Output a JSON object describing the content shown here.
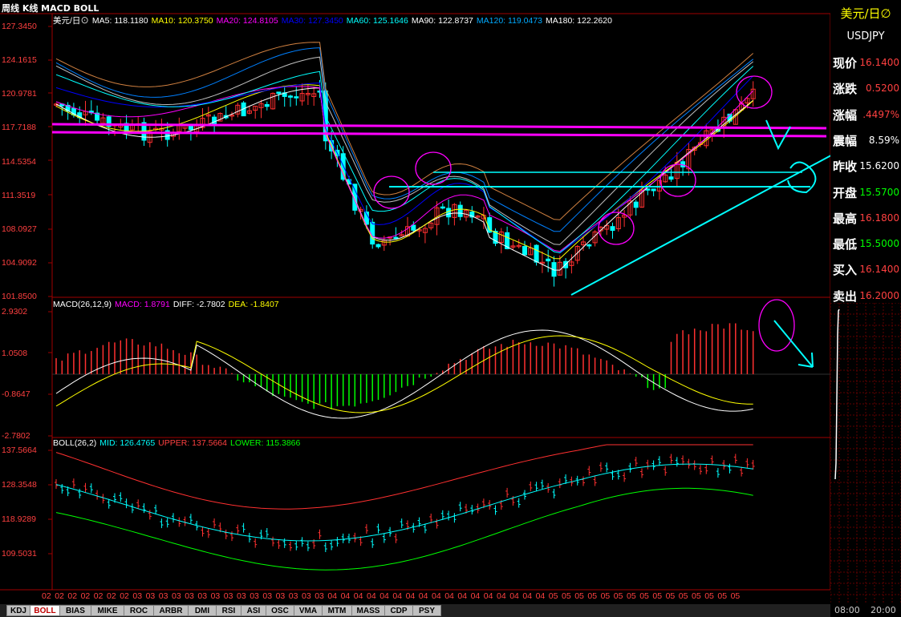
{
  "window": {
    "title": "周线 K线 MACD BOLL"
  },
  "price_panel": {
    "legend": [
      {
        "text": "美元/日⊙",
        "color": "#ffffff"
      },
      {
        "text": "MA5: 118.1180",
        "color": "#ffffff"
      },
      {
        "text": "MA10: 120.3750",
        "color": "#ffff00"
      },
      {
        "text": "MA20: 124.8105",
        "color": "#ff00ff"
      },
      {
        "text": "MA30: 127.3450",
        "color": "#0000ff"
      },
      {
        "text": "MA60: 125.1646",
        "color": "#00ffff"
      },
      {
        "text": "MA90: 122.8737",
        "color": "#ffffff"
      },
      {
        "text": "MA120: 119.0473",
        "color": "#00aaff"
      },
      {
        "text": "MA180: 122.2620",
        "color": "#ffffff"
      }
    ],
    "y_ticks": [
      "127.3450",
      "124.1615",
      "120.9781",
      "117.7188",
      "114.5354",
      "111.3519",
      "108.0927",
      "104.9092",
      "101.8500"
    ]
  },
  "macd_panel": {
    "legend": [
      {
        "text": "MACD(26,12,9)",
        "color": "#ffffff"
      },
      {
        "text": "MACD: 1.8791",
        "color": "#ff00ff"
      },
      {
        "text": "DIFF: -2.7802",
        "color": "#ffffff"
      },
      {
        "text": "DEA: -1.8407",
        "color": "#ffff00"
      }
    ],
    "y_ticks": [
      "2.9302",
      "1.0508",
      "-0.8647",
      "-2.7802"
    ]
  },
  "boll_panel": {
    "legend": [
      {
        "text": "BOLL(26,2)",
        "color": "#ffffff"
      },
      {
        "text": "MID: 126.4765",
        "color": "#00ffff"
      },
      {
        "text": "UPPER: 137.5664",
        "color": "#ff4040"
      },
      {
        "text": "LOWER: 115.3866",
        "color": "#00ff00"
      }
    ],
    "y_ticks": [
      "137.5664",
      "128.3548",
      "118.9289",
      "109.5031"
    ]
  },
  "x_axis_labels": [
    "02",
    "02",
    "02",
    "02",
    "02",
    "02",
    "02",
    "03",
    "03",
    "03",
    "03",
    "03",
    "03",
    "03",
    "03",
    "03",
    "03",
    "03",
    "03",
    "03",
    "03",
    "03",
    "04",
    "04",
    "04",
    "04",
    "04",
    "04",
    "04",
    "04",
    "04",
    "04",
    "04",
    "04",
    "04",
    "04",
    "04",
    "04",
    "04",
    "05",
    "05",
    "05",
    "05",
    "05",
    "05",
    "05",
    "05",
    "05",
    "05",
    "05",
    "05",
    "05",
    "05",
    "05"
  ],
  "quote": {
    "title": "美元/日∅",
    "code": "USDJPY",
    "rows": [
      {
        "label": "现价",
        "value": "16.1400",
        "color": "#ff4040"
      },
      {
        "label": "涨跌",
        "value": "0.5200",
        "color": "#ff4040"
      },
      {
        "label": "涨幅",
        "value": ".4497%",
        "color": "#ff4040"
      },
      {
        "label": "震幅",
        "value": "8.59%",
        "color": "#ffffff"
      },
      {
        "label": "昨收",
        "value": "15.6200",
        "color": "#ffffff"
      },
      {
        "label": "开盘",
        "value": "15.5700",
        "color": "#00ff00"
      },
      {
        "label": "最高",
        "value": "16.1800",
        "color": "#ff4040"
      },
      {
        "label": "最低",
        "value": "15.5000",
        "color": "#00ff00"
      },
      {
        "label": "买入",
        "value": "16.1400",
        "color": "#ff4040"
      },
      {
        "label": "卖出",
        "value": "16.2000",
        "color": "#ff4040"
      }
    ]
  },
  "mini_chart": {
    "times": [
      "08:00",
      "20:00"
    ]
  },
  "tabs": [
    "KDJ",
    "BOLL",
    "BIAS",
    "MIKE",
    "ROC",
    "ARBR",
    "DMI",
    "RSI",
    "ASI",
    "OSC",
    "VMA",
    "MTM",
    "MASS",
    "CDP",
    "PSY"
  ],
  "active_tab": "BOLL"
}
